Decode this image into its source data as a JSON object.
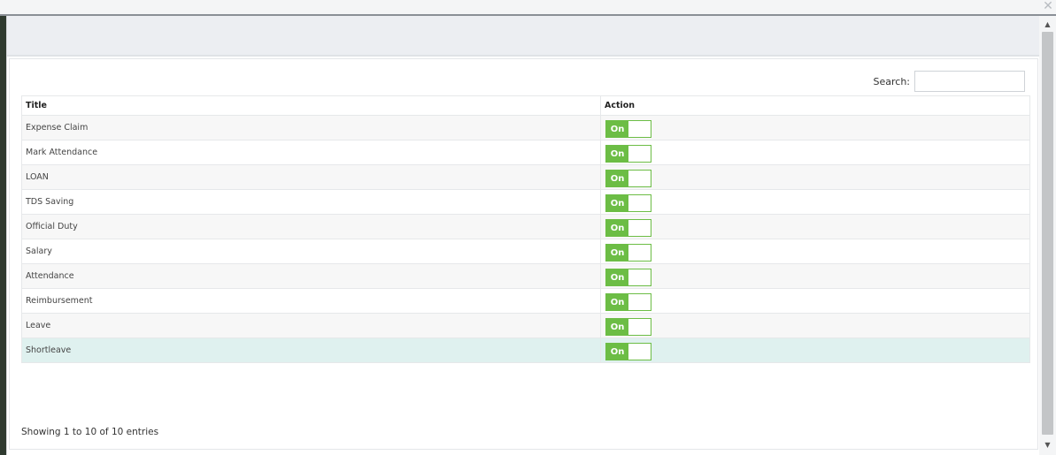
{
  "icons": {
    "close": "close-icon",
    "scroll_up": "triangle-up-icon",
    "scroll_down": "triangle-down-icon"
  },
  "colors": {
    "toggle_on": "#6cbd45",
    "row_highlight": "#dff1ef"
  },
  "search": {
    "label": "Search:",
    "value": ""
  },
  "table": {
    "columns": [
      "Title",
      "Action"
    ],
    "rows": [
      {
        "title": "Expense Claim",
        "toggle": "On"
      },
      {
        "title": "Mark Attendance",
        "toggle": "On"
      },
      {
        "title": "LOAN",
        "toggle": "On"
      },
      {
        "title": "TDS Saving",
        "toggle": "On"
      },
      {
        "title": "Official Duty",
        "toggle": "On"
      },
      {
        "title": "Salary",
        "toggle": "On"
      },
      {
        "title": "Attendance",
        "toggle": "On"
      },
      {
        "title": "Reimbursement",
        "toggle": "On"
      },
      {
        "title": "Leave",
        "toggle": "On"
      },
      {
        "title": "Shortleave",
        "toggle": "On"
      }
    ]
  },
  "info": "Showing 1 to 10 of 10 entries",
  "glyphs": {
    "close": "✕",
    "up": "▲",
    "down": "▼"
  }
}
